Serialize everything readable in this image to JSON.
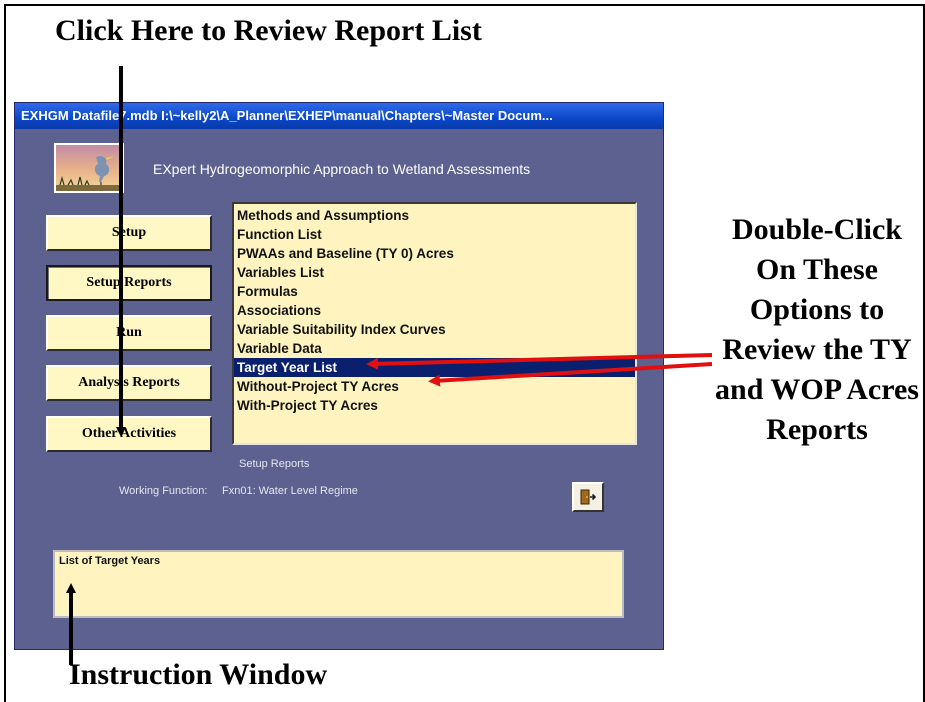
{
  "annotations": {
    "top": "Click Here to Review Report List",
    "right": "Double-Click On These Options to Review the TY and WOP Acres Reports",
    "bottom": "Instruction Window"
  },
  "window": {
    "title": "EXHGM   Datafile7.mdb   I:\\~kelly2\\A_Planner\\EXHEP\\manual\\Chapters\\~Master Docum...",
    "heading": "EXpert Hydrogeomorphic Approach to Wetland Assessments"
  },
  "nav": {
    "setup": "Setup",
    "setup_reports": "Setup Reports",
    "run": "Run",
    "analysis_reports": "Analysis Reports",
    "other_activities": "Other Activities"
  },
  "reports": {
    "items": [
      "Methods and Assumptions",
      "Function List",
      "PWAAs and Baseline (TY 0) Acres",
      "Variables List",
      "Formulas",
      "Associations",
      "Variable Suitability Index Curves",
      "Variable Data",
      "Target Year List",
      "Without-Project TY Acres",
      "With-Project TY Acres"
    ],
    "selected": "Target Year List"
  },
  "status": {
    "section": "Setup Reports",
    "working_function_label": "Working Function:",
    "working_function_value": "Fxn01: Water Level Regime"
  },
  "exit_button": {
    "icon": "exit-door-icon"
  },
  "instruction": {
    "text": "List of Target Years"
  },
  "colors": {
    "window_bg": "#5c618f",
    "panel_bg": "#fff4c0",
    "selection": "#0a1f6e",
    "titlebar": "#0a47c9",
    "arrow_red": "#e01010"
  }
}
